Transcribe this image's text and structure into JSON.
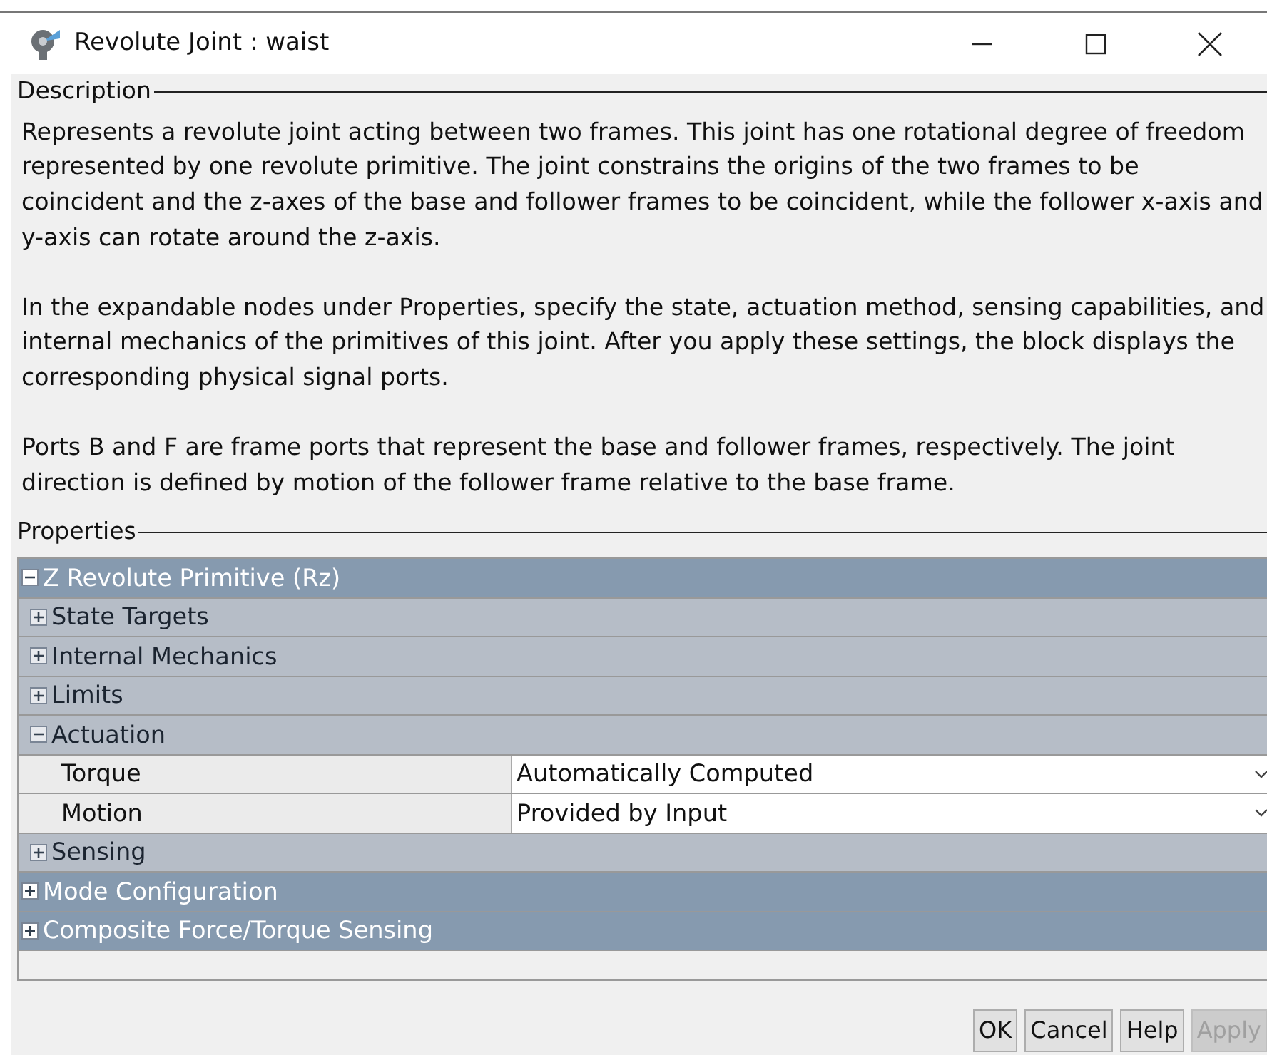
{
  "window": {
    "title": "Revolute Joint : waist"
  },
  "description": {
    "title": "Description",
    "paragraphs": [
      "Represents a revolute joint acting between two frames. This joint has one rotational degree of freedom represented by one revolute primitive. The joint constrains the origins of the two frames to be coincident and the z-axes of the base and follower frames to be coincident, while the follower x-axis and y-axis can rotate around the z-axis.",
      "In the expandable nodes under Properties, specify the state, actuation method, sensing capabilities, and internal mechanics of the primitives of this joint. After you apply these settings, the block displays the corresponding physical signal ports.",
      "Ports B and F are frame ports that represent the base and follower frames, respectively. The joint direction is defined by motion of the follower frame relative to the base frame."
    ]
  },
  "properties": {
    "title": "Properties",
    "nodes": [
      {
        "label": "Z Revolute Primitive (Rz)",
        "expanded": true,
        "children": [
          {
            "label": "State Targets",
            "expanded": false
          },
          {
            "label": "Internal Mechanics",
            "expanded": false
          },
          {
            "label": "Limits",
            "expanded": false
          },
          {
            "label": "Actuation",
            "expanded": true,
            "children": [
              {
                "kind": "dropdown",
                "label": "Torque",
                "value": "Automatically Computed"
              },
              {
                "kind": "dropdown",
                "label": "Motion",
                "value": "Provided by Input"
              }
            ]
          },
          {
            "label": "Sensing",
            "expanded": false
          }
        ]
      },
      {
        "label": "Mode Configuration",
        "expanded": false
      },
      {
        "label": "Composite Force/Torque Sensing",
        "expanded": false
      }
    ]
  },
  "buttons": [
    {
      "label": "OK",
      "disabled": false
    },
    {
      "label": "Cancel",
      "disabled": false
    },
    {
      "label": "Help",
      "disabled": false
    },
    {
      "label": "Apply",
      "disabled": true
    }
  ]
}
